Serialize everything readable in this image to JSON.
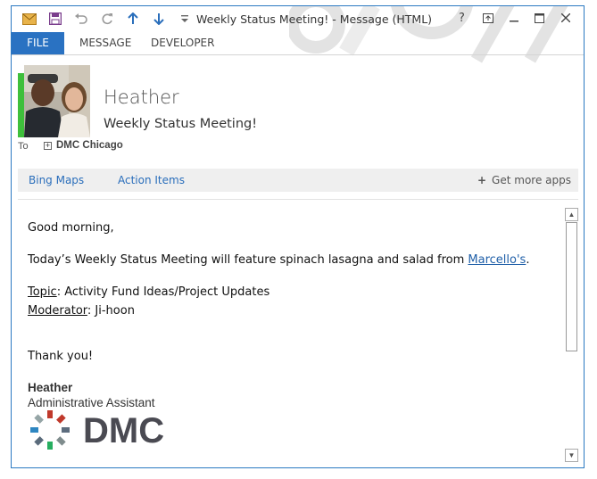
{
  "window": {
    "title": "Weekly Status Meeting! - Message (HTML)",
    "controls": {
      "help": "?",
      "restore_ribbon": "⇱",
      "minimize": "–",
      "maximize": "☐",
      "close": "✕"
    }
  },
  "quick_access": {
    "icons": [
      "mail-icon",
      "save-icon",
      "undo-icon",
      "redo-icon",
      "arrow-up-icon",
      "arrow-down-icon",
      "customize-icon"
    ]
  },
  "ribbon": {
    "tabs": [
      {
        "label": "FILE",
        "active": true
      },
      {
        "label": "MESSAGE",
        "active": false
      },
      {
        "label": "DEVELOPER",
        "active": false
      }
    ],
    "accent": "#2a72c2"
  },
  "header": {
    "sender": "Heather",
    "subject": "Weekly Status Meeting!",
    "to_label": "To",
    "to_value": "DMC Chicago",
    "presence_color": "#3ebf3b"
  },
  "apps_bar": {
    "apps": [
      "Bing Maps",
      "Action Items"
    ],
    "get_more": "Get more apps"
  },
  "message": {
    "greeting": "Good morning,",
    "line1_prefix": "Today’s Weekly Status Meeting will feature spinach lasagna and salad from ",
    "line1_link": "Marcello's",
    "line1_suffix": ".",
    "topic_label": "Topic",
    "topic_value": ": Activity Fund Ideas/Project Updates",
    "moderator_label": "Moderator",
    "moderator_value": ": Ji-hoon",
    "closing": "Thank you!",
    "signature_name": "Heather",
    "signature_title": "Administrative Assistant",
    "logo_text": "DMC"
  }
}
